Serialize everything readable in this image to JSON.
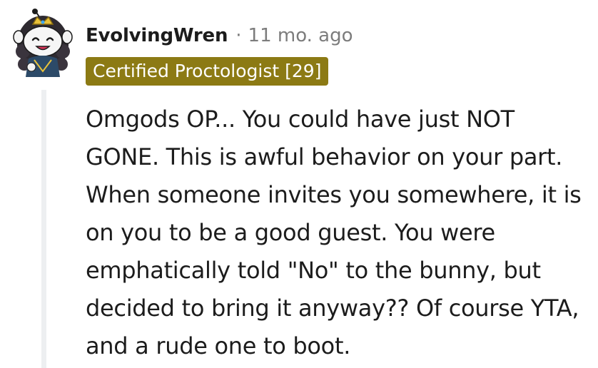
{
  "comment": {
    "author": "EvolvingWren",
    "separator": "·",
    "timestamp": "11 mo. ago",
    "flair": "Certified Proctologist [29]",
    "body": "Omgods OP... You could have just NOT GONE. This is awful behavior on your part. When someone invites you somewhere, it is on you to be a good guest. You were emphatically told \"No\" to the bunny, but decided to bring it anyway?? Of course YTA, and a rude one to boot."
  },
  "colors": {
    "flair_background": "#8c7a14",
    "meta_text": "#7c7c7c",
    "thread_line": "#edeff1"
  },
  "icons": {
    "avatar": "snoo-avatar-icon"
  }
}
